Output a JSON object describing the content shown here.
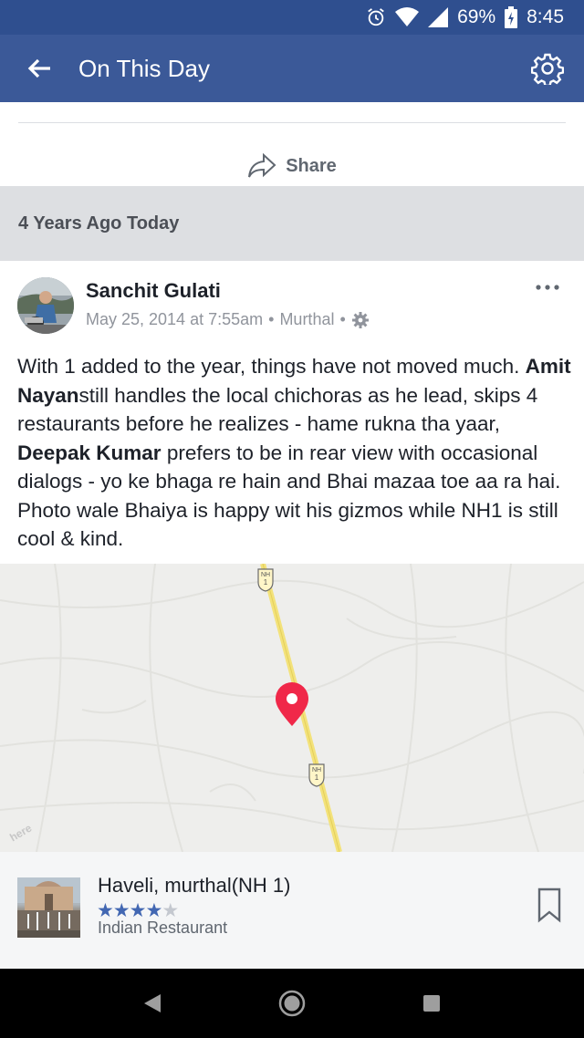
{
  "status_bar": {
    "battery": "69%",
    "time": "8:45",
    "icons": [
      "alarm-icon",
      "wifi-icon",
      "signal-icon",
      "battery-charging-icon"
    ]
  },
  "app_bar": {
    "title": "On This Day",
    "back_icon": "back-arrow-icon",
    "settings_icon": "gear-icon"
  },
  "share": {
    "label": "Share",
    "icon": "share-arrow-icon"
  },
  "section": {
    "header": "4 Years Ago Today"
  },
  "post": {
    "author": "Sanchit Gulati",
    "date": "May 25, 2014 at 7:55am",
    "separator": "•",
    "location": "Murthal",
    "privacy_icon": "gear-icon",
    "more_icon": "more-dots-icon",
    "text": {
      "p1": "With 1 added to the year, things have not moved much. ",
      "tag1": "Amit Nayan",
      "p2": "still handles the local chichoras as he lead, skips 4 restaurants before he realizes - hame rukna tha yaar, ",
      "tag2": "Deepak Kumar",
      "p3": " prefers to be in rear view with occasional  dialogs - yo ke bhaga re hain and Bhai mazaa toe aa ra hai. Photo wale Bhaiya is happy wit his gizmos while NH1 is still cool & kind."
    }
  },
  "map": {
    "road_label": "NH",
    "road_number": "1",
    "attribution": "here",
    "pin_color": "#f02849",
    "road_color": "#f3e27a"
  },
  "place": {
    "name": "Haveli, murthal(NH 1)",
    "rating": 4,
    "rating_max": 5,
    "category": "Indian Restaurant",
    "bookmark_icon": "bookmark-icon"
  },
  "nav": {
    "icons": [
      "back-triangle-icon",
      "home-circle-icon",
      "recents-square-icon"
    ]
  },
  "colors": {
    "brand": "#3b5998",
    "status_bar": "#2f4f8f",
    "star": "#4267b2"
  }
}
